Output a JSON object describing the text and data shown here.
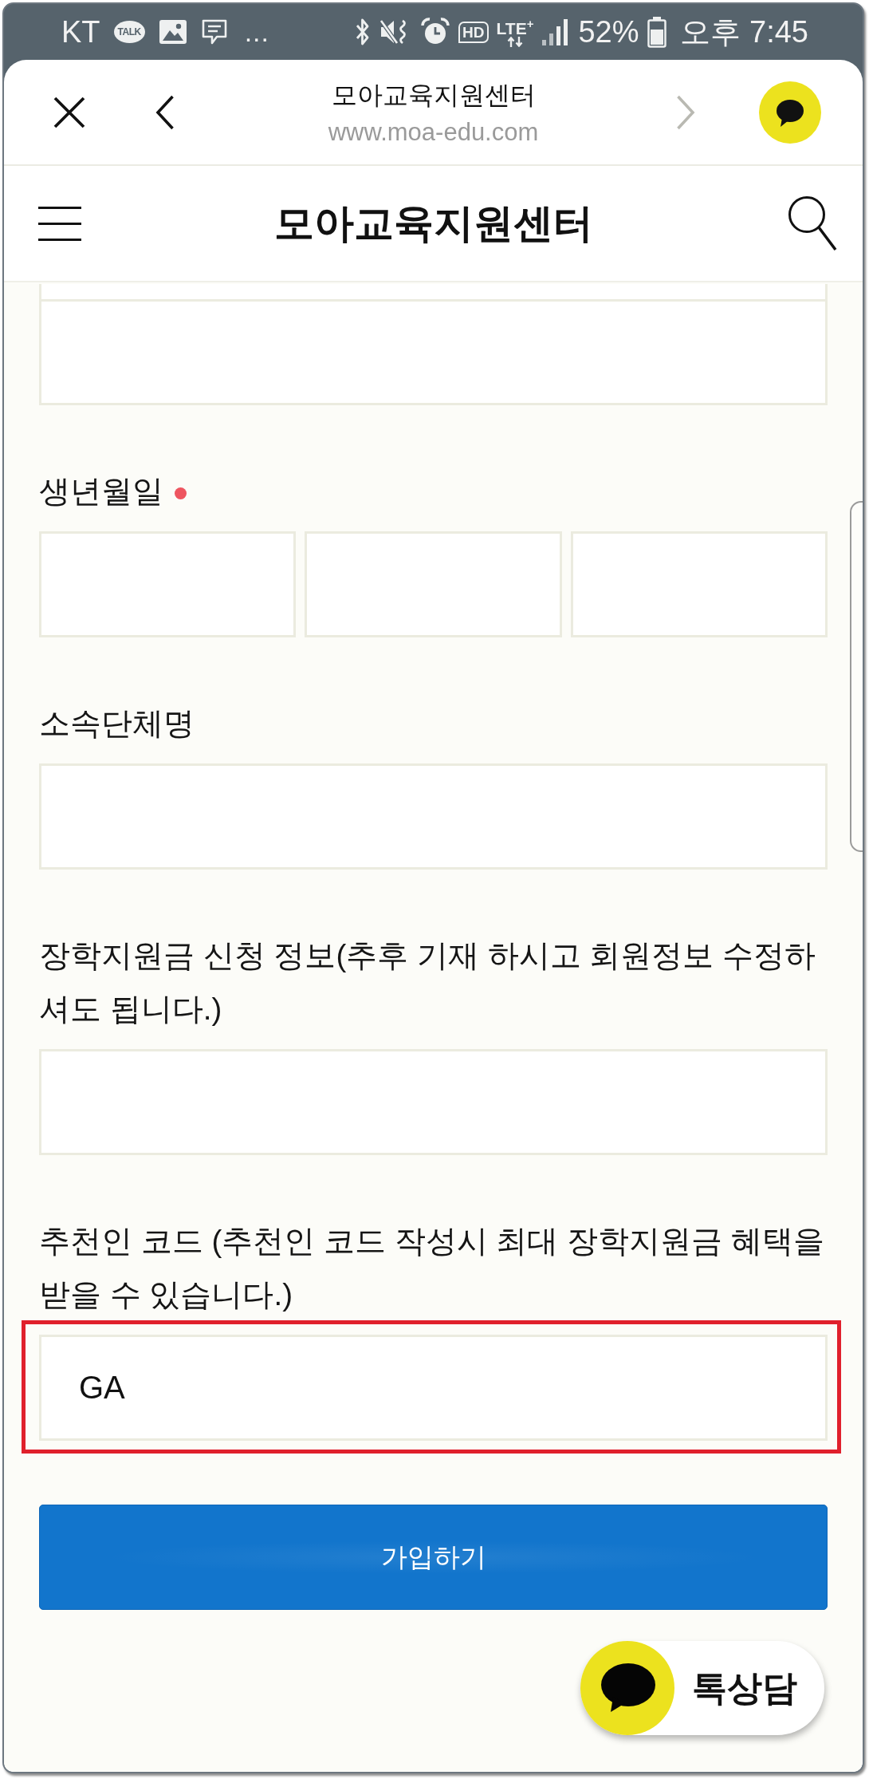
{
  "status_bar": {
    "carrier": "KT",
    "notifications": [
      {
        "kind": "talk",
        "label": "TALK"
      },
      {
        "kind": "gallery"
      },
      {
        "kind": "message"
      }
    ],
    "overflow": "...",
    "system": [
      {
        "kind": "bluetooth"
      },
      {
        "kind": "mute"
      },
      {
        "kind": "alarm"
      },
      {
        "kind": "hd",
        "label": "HD"
      },
      {
        "kind": "network",
        "label": "LTE$^{+}$"
      },
      {
        "kind": "signal"
      }
    ],
    "battery": "52%",
    "time": "오후 7:45"
  },
  "browser_bar": {
    "title": "모아교육지원센터",
    "url": "www.moa-edu.com",
    "forward_disabled": true
  },
  "site_header": {
    "title": "모아교육지원센터"
  },
  "form": {
    "sections": [
      {
        "kind": "stack",
        "inputs": [
          {
            "kind": "clipped",
            "highlighted": false
          },
          {
            "kind": "box",
            "highlighted": false
          }
        ]
      },
      {
        "kind": "row",
        "label": "생년월일",
        "required": true,
        "inputs": [
          {
            "kind": "box",
            "highlighted": false
          },
          {
            "kind": "box",
            "highlighted": false
          },
          {
            "kind": "box",
            "highlighted": false
          }
        ]
      },
      {
        "kind": "stack",
        "label": "소속단체명",
        "required": false,
        "inputs": [
          {
            "kind": "box",
            "highlighted": false
          }
        ]
      },
      {
        "kind": "stack",
        "label": "장학지원금 신청 정보(추후 기재 하시고 회원정보 수정하셔도 됩니다.)",
        "required": false,
        "inputs": [
          {
            "kind": "box",
            "highlighted": false
          }
        ]
      },
      {
        "kind": "stack",
        "label": "추천인 코드 (추천인 코드 작성시 최대 장학지원금 혜택을 받을 수 있습니다.)",
        "required": false,
        "inputs": [
          {
            "kind": "box",
            "value": "GA",
            "highlighted": true
          }
        ]
      }
    ],
    "submit": "가입하기"
  },
  "chat_button": {
    "label": "톡상담"
  }
}
